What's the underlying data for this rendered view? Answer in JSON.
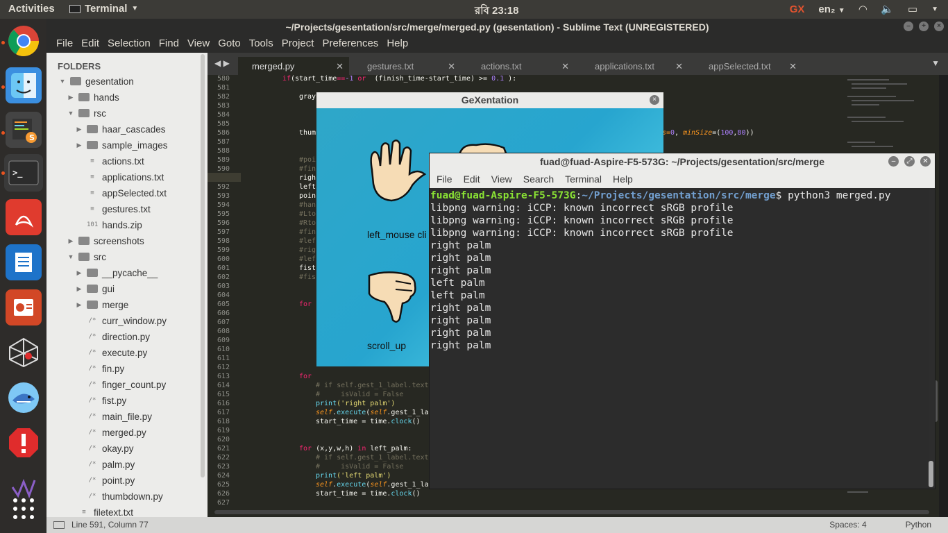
{
  "topbar": {
    "activities": "Activities",
    "app_name": "Terminal",
    "clock": "রবি 23:18",
    "lang": "en₂"
  },
  "window": {
    "title": "~/Projects/gesentation/src/merge/merged.py (gesentation) - Sublime Text (UNREGISTERED)"
  },
  "menu": [
    "File",
    "Edit",
    "Selection",
    "Find",
    "View",
    "Goto",
    "Tools",
    "Project",
    "Preferences",
    "Help"
  ],
  "sidebar": {
    "heading": "FOLDERS",
    "items": [
      {
        "label": "gesentation",
        "kind": "folder-open"
      },
      {
        "label": "hands",
        "kind": "folder"
      },
      {
        "label": "rsc",
        "kind": "folder-open"
      },
      {
        "label": "haar_cascades",
        "kind": "folder"
      },
      {
        "label": "sample_images",
        "kind": "folder"
      },
      {
        "label": "actions.txt",
        "kind": "file"
      },
      {
        "label": "applications.txt",
        "kind": "file"
      },
      {
        "label": "appSelected.txt",
        "kind": "file"
      },
      {
        "label": "gestures.txt",
        "kind": "file"
      },
      {
        "label": "hands.zip",
        "kind": "zip"
      },
      {
        "label": "screenshots",
        "kind": "folder"
      },
      {
        "label": "src",
        "kind": "folder-open"
      },
      {
        "label": "__pycache__",
        "kind": "folder"
      },
      {
        "label": "gui",
        "kind": "folder"
      },
      {
        "label": "merge",
        "kind": "folder"
      },
      {
        "label": "curr_window.py",
        "kind": "py"
      },
      {
        "label": "direction.py",
        "kind": "py"
      },
      {
        "label": "execute.py",
        "kind": "py"
      },
      {
        "label": "fin.py",
        "kind": "py"
      },
      {
        "label": "finger_count.py",
        "kind": "py"
      },
      {
        "label": "fist.py",
        "kind": "py"
      },
      {
        "label": "main_file.py",
        "kind": "py"
      },
      {
        "label": "merged.py",
        "kind": "py"
      },
      {
        "label": "okay.py",
        "kind": "py"
      },
      {
        "label": "palm.py",
        "kind": "py"
      },
      {
        "label": "point.py",
        "kind": "py"
      },
      {
        "label": "thumbdown.py",
        "kind": "py"
      },
      {
        "label": "filetext.txt",
        "kind": "file"
      }
    ]
  },
  "tabs": [
    {
      "label": "merged.py",
      "active": true
    },
    {
      "label": "gestures.txt",
      "active": false
    },
    {
      "label": "actions.txt",
      "active": false
    },
    {
      "label": "applications.txt",
      "active": false
    },
    {
      "label": "appSelected.txt",
      "active": false
    }
  ],
  "editor": {
    "line_numbers": [
      "580",
      "581",
      "582",
      "583",
      "584",
      "585",
      "586",
      "587",
      "588",
      "589",
      "590",
      "591",
      "592",
      "593",
      "594",
      "595",
      "596",
      "597",
      "598",
      "599",
      "600",
      "601",
      "602",
      "603",
      "604",
      "605",
      "606",
      "607",
      "608",
      "609",
      "610",
      "611",
      "612",
      "613",
      "614",
      "615",
      "616",
      "617",
      "618",
      "619",
      "620",
      "621",
      "622",
      "623",
      "624",
      "625",
      "626",
      "627"
    ],
    "current_line": "591",
    "code": {
      "l581a": "if",
      "l581b": "(start_time",
      "l581c": "==",
      "l581d": "-1",
      "l581e": " or ",
      "l581f": " (finish_time-start_time) >= ",
      "l581g": "0.1",
      "l581h": " ):",
      "l582": "gray",
      "l586": "thum",
      "l586r1": "s=",
      "l586r2": "0",
      "l586r3": ", ",
      "l586r4": "minSize",
      "l586r5": "=(",
      "l586r6": "100",
      "l586r7": ",",
      "l586r8": "80",
      "l586r9": "))",
      "l589": "#poi",
      "l590": "#fin",
      "l591": "righ",
      "l592": "left",
      "l593": "poin",
      "l594": "#han",
      "l595": "#Lto",
      "l596": "#Rto",
      "l597": "#fin",
      "l598": "#lef",
      "l599": "#rig",
      "l600": "#lef",
      "l601": "fist",
      "l602": "#fis",
      "l605": "for",
      "l613": "for",
      "l614": "# if self.gest_1_label.text",
      "l615": "#     isValid = False",
      "l616a": "print",
      "l616b": "('right palm')",
      "l617a": "self",
      "l617b": ".",
      "l617c": "execute",
      "l617d": "(",
      "l617e": "self",
      "l617f": ".gest_1_la",
      "l618a": "start_time = time.",
      "l618b": "clock",
      "l618c": "()",
      "l621a": "for",
      "l621b": " (x,y,w,h) ",
      "l621c": "in",
      "l621d": " left_palm:",
      "l622": "# if self.gest_1_label.text",
      "l623": "#     isValid = False",
      "l624a": "print",
      "l624b": "('left palm')",
      "l625a": "self",
      "l625b": ".",
      "l625c": "execute",
      "l625d": "(",
      "l625e": "self",
      "l625f": ".gest_1_la",
      "l626a": "start_time = time.",
      "l626b": "clock",
      "l626c": "()"
    }
  },
  "statusbar": {
    "position": "Line 591, Column 77",
    "indent": "Spaces: 4",
    "syntax": "Python"
  },
  "gex": {
    "title": "GeXentation",
    "label1": "left_mouse cli",
    "label2": "scroll_up"
  },
  "terminal": {
    "title": "fuad@fuad-Aspire-F5-573G: ~/Projects/gesentation/src/merge",
    "menu": [
      "File",
      "Edit",
      "View",
      "Search",
      "Terminal",
      "Help"
    ],
    "prompt_user": "fuad@fuad-Aspire-F5-573G",
    "prompt_sep": ":",
    "prompt_path": "~/Projects/gesentation/src/merge",
    "prompt_cmd": "$ python3 merged.py",
    "output": [
      "libpng warning: iCCP: known incorrect sRGB profile",
      "libpng warning: iCCP: known incorrect sRGB profile",
      "libpng warning: iCCP: known incorrect sRGB profile",
      "right palm",
      "right palm",
      "right palm",
      "left palm",
      "left palm",
      "right palm",
      "right palm",
      "right palm",
      "right palm"
    ]
  },
  "dock": [
    {
      "name": "chrome-icon",
      "color": "#dd4b39"
    },
    {
      "name": "finder-icon",
      "color": "#3b8fe0"
    },
    {
      "name": "sublime-icon",
      "color": "#4a4a4a"
    },
    {
      "name": "terminal-icon",
      "color": "#2c2c2c"
    },
    {
      "name": "pdf-icon",
      "color": "#e03b2e"
    },
    {
      "name": "document-icon",
      "color": "#1e73c9"
    },
    {
      "name": "presentation-icon",
      "color": "#d24726"
    },
    {
      "name": "network-icon",
      "color": "#3a3a3a"
    },
    {
      "name": "shark-icon",
      "color": "#2e7fd6"
    },
    {
      "name": "alert-icon",
      "color": "#e02c2c"
    },
    {
      "name": "vs-icon",
      "color": "#2e2c2a"
    },
    {
      "name": "apps-grid-icon",
      "color": "#2e2c2a"
    }
  ]
}
